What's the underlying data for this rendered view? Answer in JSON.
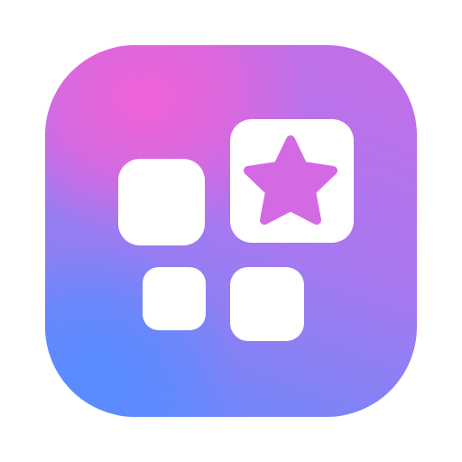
{
  "icon": {
    "name": "apps-grid-with-star-icon",
    "colors": {
      "gradient_pink": "#f460d6",
      "gradient_purple": "#b07ef2",
      "gradient_blue": "#5c8cff",
      "glyph": "#ffffff"
    }
  }
}
